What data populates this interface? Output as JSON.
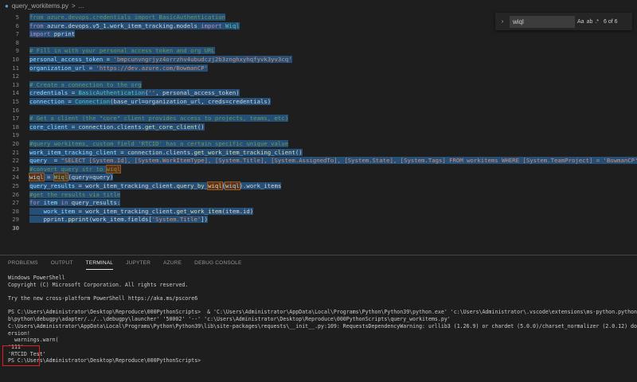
{
  "breadcrumb": {
    "file": "query_workitems.py",
    "separator": ">",
    "more": "..."
  },
  "find": {
    "value": "wiql",
    "options": [
      "Aa",
      "ab",
      ".*"
    ],
    "count": "6 of 6",
    "close": "×"
  },
  "editor": {
    "lines": [
      {
        "n": 5,
        "segs": [
          [
            "cm",
            "from azure.devops.credentials import BasicAuthentication"
          ]
        ]
      },
      {
        "n": 6,
        "segs": [
          [
            "kw",
            "from "
          ],
          [
            "plain",
            "azure.devops.v5_1.work_item_tracking.models "
          ],
          [
            "kw",
            "import "
          ],
          [
            "cls",
            "Wiql"
          ]
        ]
      },
      {
        "n": 7,
        "segs": [
          [
            "kw",
            "import "
          ],
          [
            "plain",
            "pprint"
          ]
        ]
      },
      {
        "n": 8,
        "segs": []
      },
      {
        "n": 9,
        "segs": [
          [
            "cm",
            "# Fill in with your personal access token and org URL"
          ]
        ]
      },
      {
        "n": 10,
        "segs": [
          [
            "var",
            "personal_access_token"
          ],
          [
            "plain",
            " = "
          ],
          [
            "str",
            "'bmpcunvngrjyz4orrzhv4ubudczj2b3znghxyhqfyvk3yv3cq'"
          ]
        ]
      },
      {
        "n": 11,
        "segs": [
          [
            "var",
            "organization_url"
          ],
          [
            "plain",
            " = "
          ],
          [
            "str",
            "'https://dev.azure.com/BowmanCP'"
          ]
        ]
      },
      {
        "n": 12,
        "segs": []
      },
      {
        "n": 13,
        "segs": [
          [
            "cm",
            "# Create a connection to the org"
          ]
        ]
      },
      {
        "n": 14,
        "segs": [
          [
            "var",
            "credentials"
          ],
          [
            "plain",
            " = "
          ],
          [
            "cls",
            "BasicAuthentication"
          ],
          [
            "plain",
            "("
          ],
          [
            "str",
            "''"
          ],
          [
            "plain",
            ", personal_access_token)"
          ]
        ]
      },
      {
        "n": 15,
        "segs": [
          [
            "var",
            "connection"
          ],
          [
            "plain",
            " = "
          ],
          [
            "cls",
            "Connection"
          ],
          [
            "plain",
            "(base_url=organization_url, creds=credentials)"
          ]
        ]
      },
      {
        "n": 16,
        "segs": []
      },
      {
        "n": 17,
        "segs": [
          [
            "cm",
            "# Get a client (the \"core\" client provides access to projects, teams, etc)"
          ]
        ]
      },
      {
        "n": 18,
        "segs": [
          [
            "var",
            "core_client"
          ],
          [
            "plain",
            " = connection.clients."
          ],
          [
            "fn",
            "get_core_client"
          ],
          [
            "plain",
            "()"
          ]
        ]
      },
      {
        "n": 19,
        "segs": []
      },
      {
        "n": 20,
        "segs": [
          [
            "cm",
            "#query workitems, custom field 'RTCID' has a certain specific unique value"
          ]
        ]
      },
      {
        "n": 21,
        "segs": [
          [
            "var",
            "work_item_tracking_client"
          ],
          [
            "plain",
            " = connection.clients."
          ],
          [
            "fn",
            "get_work_item_tracking_client"
          ],
          [
            "plain",
            "()"
          ]
        ]
      },
      {
        "n": 22,
        "segs": [
          [
            "var",
            "query"
          ],
          [
            "plain",
            "  = "
          ],
          [
            "str",
            "\"SELECT [System.Id], [System.WorkItemType], [System.Title], [System.AssignedTo], [System.State], [System.Tags] FROM workitems WHERE [System.TeamProject] = 'BowmanCP' AND"
          ]
        ]
      },
      {
        "n": 23,
        "segs": [
          [
            "cm",
            "#convert query str to "
          ],
          [
            "cm-find",
            "wiql"
          ]
        ]
      },
      {
        "n": 24,
        "segs": [
          [
            "var-find",
            "wiql"
          ],
          [
            "plain",
            " = "
          ],
          [
            "cls-find",
            "Wiql"
          ],
          [
            "plain",
            "(query=query)"
          ]
        ]
      },
      {
        "n": 25,
        "segs": [
          [
            "var",
            "query_results"
          ],
          [
            "plain",
            " = work_item_tracking_client."
          ],
          [
            "fn",
            "query_by_"
          ],
          [
            "fn-find",
            "wiql"
          ],
          [
            "plain",
            "("
          ],
          [
            "var-find",
            "wiql"
          ],
          [
            "plain",
            ").work_items"
          ]
        ]
      },
      {
        "n": 26,
        "segs": [
          [
            "cm",
            "#get the results via title"
          ]
        ]
      },
      {
        "n": 27,
        "segs": [
          [
            "kw",
            "for "
          ],
          [
            "var",
            "item"
          ],
          [
            "kw",
            " in "
          ],
          [
            "plain",
            "query_results:"
          ]
        ]
      },
      {
        "n": 28,
        "segs": [
          [
            "plain",
            "    "
          ],
          [
            "var",
            "work_item"
          ],
          [
            "plain",
            " = work_item_tracking_client."
          ],
          [
            "fn",
            "get_work_item"
          ],
          [
            "plain",
            "(item.id)"
          ]
        ]
      },
      {
        "n": 29,
        "segs": [
          [
            "plain",
            "    pprint."
          ],
          [
            "fn",
            "pprint"
          ],
          [
            "plain",
            "(work_item.fields["
          ],
          [
            "str",
            "'System.Title'"
          ],
          [
            "plain",
            "])"
          ]
        ]
      },
      {
        "n": 30,
        "segs": []
      }
    ]
  },
  "panel": {
    "tabs": [
      "PROBLEMS",
      "OUTPUT",
      "TERMINAL",
      "JUPYTER",
      "AZURE",
      "DEBUG CONSOLE"
    ],
    "active_tab": "TERMINAL",
    "terminal": [
      "Windows PowerShell",
      "Copyright (C) Microsoft Corporation. All rights reserved.",
      "",
      "Try the new cross-platform PowerShell https://aka.ms/pscore6",
      "",
      "PS C:\\Users\\Administrator\\Desktop\\Reproduce\\000PythonScripts>  & 'C:\\Users\\Administrator\\AppData\\Local\\Programs\\Python\\Python39\\python.exe' 'c:\\Users\\Administrator\\.vscode\\extensions\\ms-python.python-2022",
      "b\\python\\debugpy\\adapter/../..\\debugpy\\launcher' '50002' '--' 'c:\\Users\\Administrator\\Desktop\\Reproduce\\000PythonScripts\\query_workitems.py'",
      "C:\\Users\\Administrator\\AppData\\Local\\Programs\\Python\\Python39\\lib\\site-packages\\requests\\__init__.py:109: RequestsDependencyWarning: urllib3 (1.26.9) or chardet (5.0.0)/charset_normalizer (2.0.12) doesn'",
      "ersion!",
      "  warnings.warn(",
      "'111'",
      "'RTCID Test'",
      "PS C:\\Users\\Administrator\\Desktop\\Reproduce\\000PythonScripts> "
    ]
  }
}
